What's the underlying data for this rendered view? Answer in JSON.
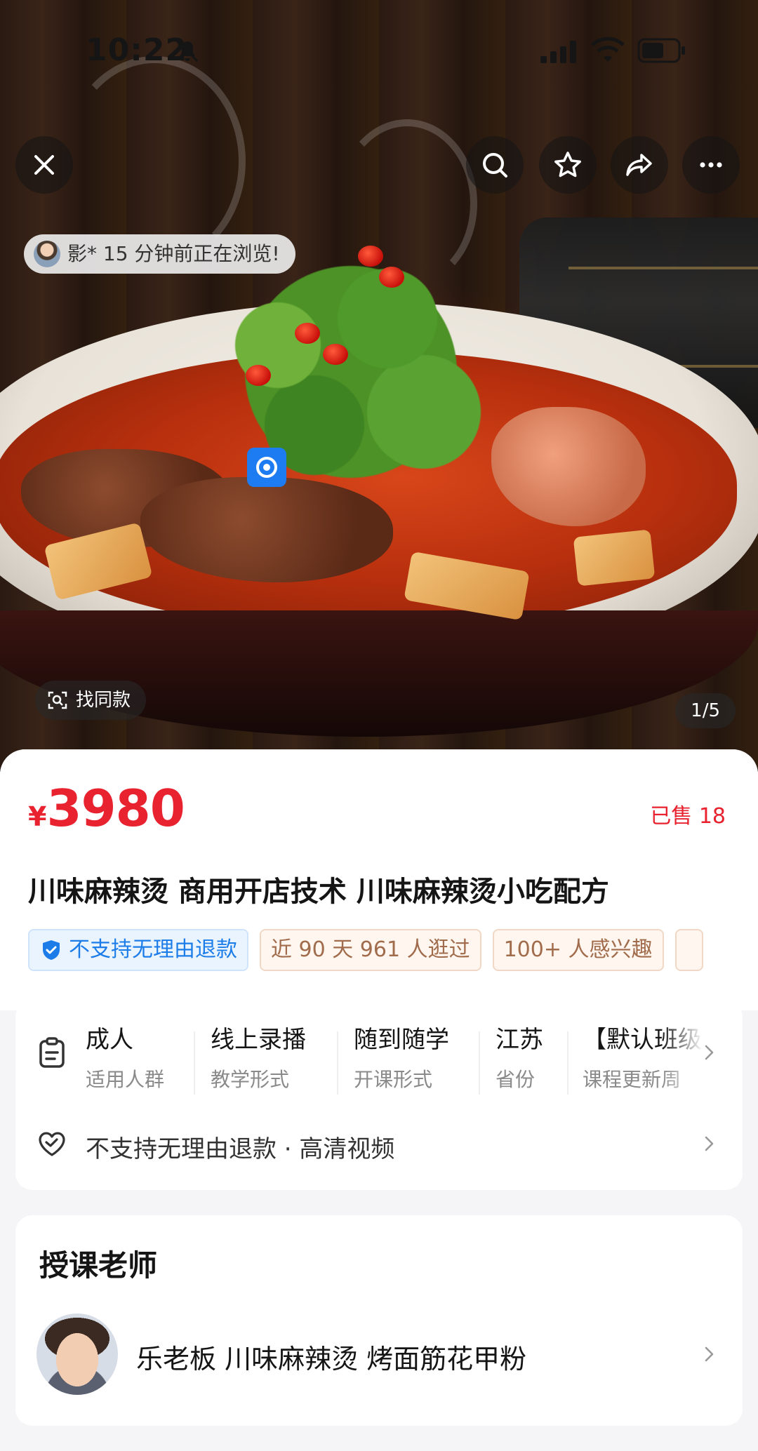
{
  "status_bar": {
    "time": "10:22"
  },
  "hero": {
    "browse_notice": "影* 15 分钟前正在浏览!",
    "find_same": "找同款",
    "page_indicator": "1/5"
  },
  "product": {
    "currency": "¥",
    "price": "3980",
    "sold": "已售 18",
    "title": "川味麻辣烫 商用开店技术 川味麻辣烫小吃配方",
    "tags": [
      {
        "text": "不支持无理由退款",
        "style": "blue"
      },
      {
        "text": "近 90 天 961 人逛过",
        "style": "brown"
      },
      {
        "text": "100+ 人感兴趣",
        "style": "brown"
      }
    ]
  },
  "attributes": [
    {
      "value": "成人",
      "label": "适用人群"
    },
    {
      "value": "线上录播",
      "label": "教学形式"
    },
    {
      "value": "随到随学",
      "label": "开课形式"
    },
    {
      "value": "江苏",
      "label": "省份"
    },
    {
      "value": "【默认班级",
      "label": "课程更新周"
    }
  ],
  "service": {
    "text": "不支持无理由退款 · 高清视频"
  },
  "teacher": {
    "heading": "授课老师",
    "name": "乐老板 川味麻辣烫 烤面筋花甲粉"
  },
  "colors": {
    "price_red": "#e8222f",
    "tag_blue": "#1d7de8",
    "tag_brown": "#a16c4c"
  }
}
